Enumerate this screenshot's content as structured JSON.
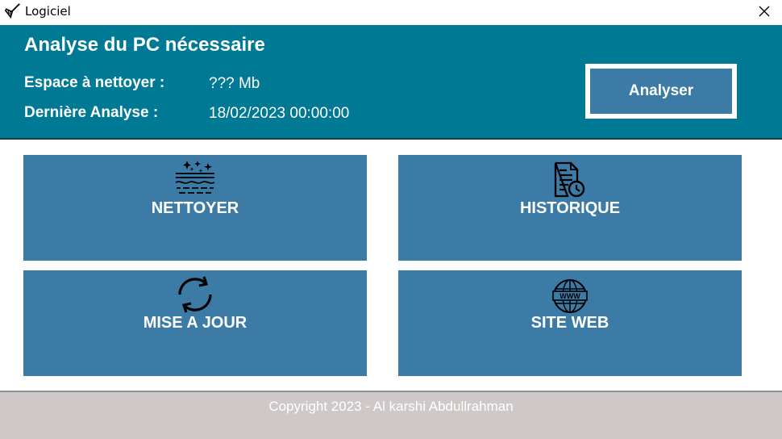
{
  "window": {
    "title": "Logiciel",
    "app_icon": "broom-icon",
    "close_icon": "close-icon"
  },
  "header": {
    "title": "Analyse du PC nécessaire",
    "space_label": "Espace à nettoyer :",
    "space_value": "??? Mb",
    "last_label": "Dernière Analyse :",
    "last_value": "18/02/2023 00:00:00",
    "analyze_button": "Analyser"
  },
  "tiles": [
    {
      "label": "NETTOYER",
      "icon": "sparkling-clean-icon"
    },
    {
      "label": "HISTORIQUE",
      "icon": "document-clock-icon"
    },
    {
      "label": "MISE A JOUR",
      "icon": "refresh-icon"
    },
    {
      "label": "SITE WEB",
      "icon": "globe-www-icon"
    }
  ],
  "footer": {
    "copyright": "Copyright 2023 - Al karshi Abdullrahman"
  },
  "colors": {
    "header_bg": "#007a94",
    "tile_bg": "#3d7ba7",
    "footer_bg": "#cfc8c8"
  }
}
